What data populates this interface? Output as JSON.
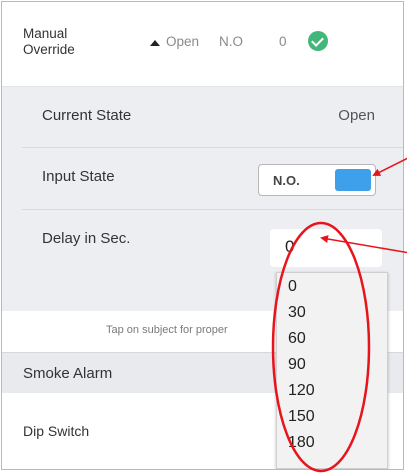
{
  "header": {
    "title": "Manual Override",
    "state": "Open",
    "input_type": "N.O",
    "delay": "0",
    "status_color": "#43b77a"
  },
  "current_state": {
    "label": "Current State",
    "value": "Open"
  },
  "input_state": {
    "label": "Input State",
    "toggle_label": "N.O.",
    "toggle_color": "#3ea0ea"
  },
  "delay": {
    "label": "Delay in Sec.",
    "value": "0",
    "options": [
      "0",
      "30",
      "60",
      "90",
      "120",
      "150",
      "180"
    ]
  },
  "tap_note": "Tap on subject for proper",
  "smoke_alarm": {
    "title": "Smoke Alarm"
  },
  "dip_switch": {
    "label": "Dip Switch"
  },
  "annotation_color": "#e8141c"
}
